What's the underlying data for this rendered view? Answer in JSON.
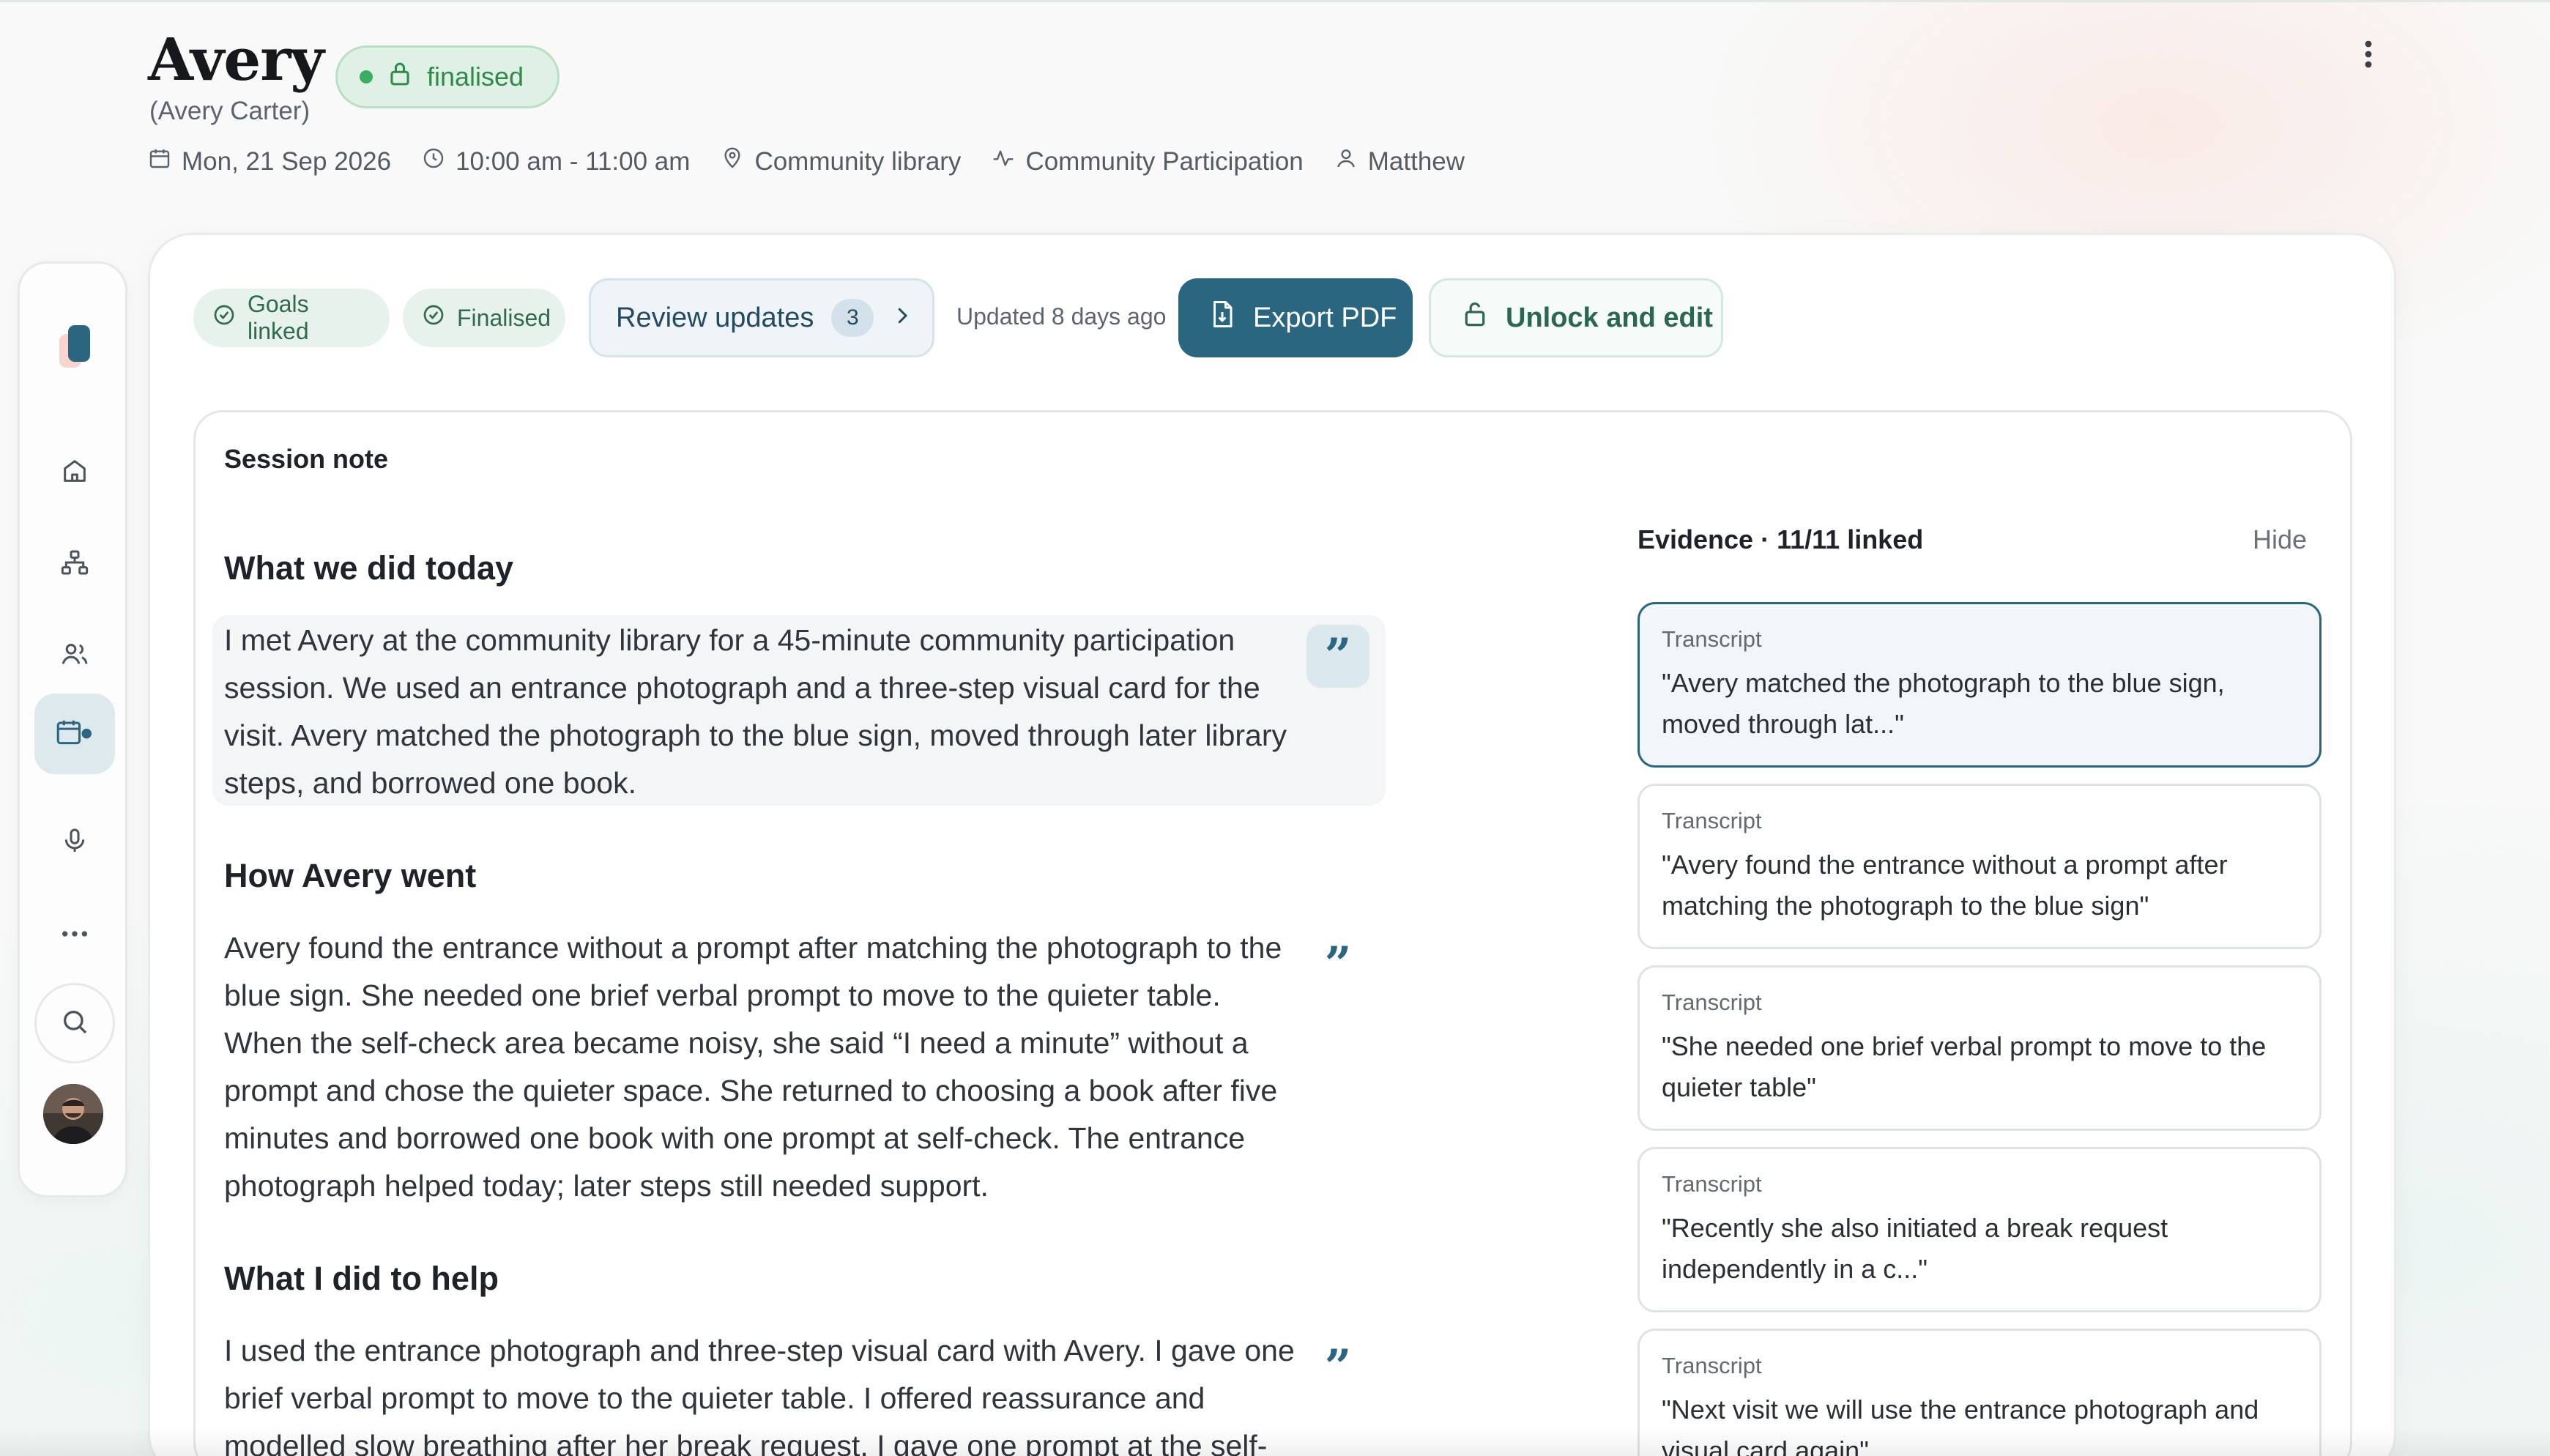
{
  "header": {
    "name": "Avery",
    "full_name": "(Avery Carter)",
    "status": "finalised",
    "date": "Mon, 21 Sep 2026",
    "time": "10:00 am - 11:00 am",
    "location": "Community library",
    "activity": "Community Participation",
    "worker": "Matthew"
  },
  "sidebar": {
    "items": [
      "home-icon",
      "org-chart-icon",
      "people-icon",
      "calendar-icon",
      "microphone-icon",
      "more-icon",
      "search-icon"
    ],
    "active": "calendar-icon"
  },
  "toolbar": {
    "chip_goals": "Goals linked",
    "chip_finalised": "Finalised",
    "review_label": "Review updates",
    "review_count": "3",
    "updated": "Updated 8 days ago",
    "export_label": "Export PDF",
    "unlock_label": "Unlock and edit"
  },
  "note": {
    "label": "Session note",
    "sections": [
      {
        "heading": "What we did today",
        "body": "I met Avery at the community library for a 45-minute community participation session. We used an entrance photograph and a three-step visual card for the visit. Avery matched the photograph to the blue sign, moved through later library steps, and borrowed one book."
      },
      {
        "heading": "How Avery went",
        "body": "Avery found the entrance without a prompt after matching the photograph to the blue sign. She needed one brief verbal prompt to move to the quieter table. When the self-check area became noisy, she said “I need a minute” without a prompt and chose the quieter space. She returned to choosing a book after five minutes and borrowed one book with one prompt at self-check. The entrance photograph helped today; later steps still needed support."
      },
      {
        "heading": "What I did to help",
        "body": "I used the entrance photograph and three-step visual card with Avery. I gave one brief verbal prompt to move to the quieter table. I offered reassurance and modelled slow breathing after her break request. I gave one prompt at the self-"
      }
    ]
  },
  "evidence": {
    "title": "Evidence · 11/11 linked",
    "hide_label": "Hide",
    "items": [
      {
        "type": "Transcript",
        "text": "\"Avery matched the photograph to the blue sign, moved through lat...\""
      },
      {
        "type": "Transcript",
        "text": "\"Avery found the entrance without a prompt after matching the photograph to the blue sign\""
      },
      {
        "type": "Transcript",
        "text": "\"She needed one brief verbal prompt to move to the quieter table\""
      },
      {
        "type": "Transcript",
        "text": "\"Recently she also initiated a break request independently in a c...\""
      },
      {
        "type": "Transcript",
        "text": "\"Next visit we will use the entrance photograph and visual card again\""
      }
    ]
  },
  "colors": {
    "accent": "#2b6680",
    "success": "#3cae63",
    "chip_bg": "#e7f2ec"
  }
}
